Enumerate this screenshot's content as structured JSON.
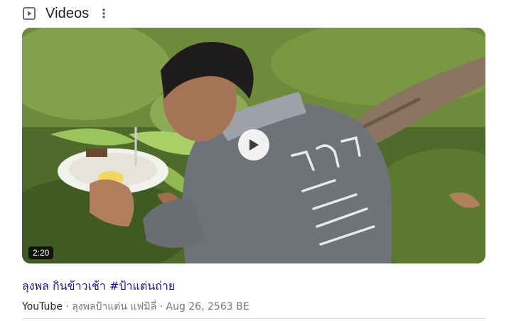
{
  "section": {
    "title": "Videos",
    "icon": "video-play-icon",
    "menu_icon": "more-vert-icon"
  },
  "video": {
    "duration": "2:20",
    "title": "ลุงพล กินข้าวเช้า #ป้าแต่นถ่าย",
    "source": "YouTube",
    "separator": "·",
    "channel": "ลุงพลป้าแต่น แฟมิลี่",
    "date": "Aug 26, 2563 BE",
    "shirt_text": [
      "ร้านลุงพล",
      "อ.นาแซง",
      "ป.บางคาย",
      "โทร.๐๙๗๙๘๖",
      "โทร.๐๑๕๘๔"
    ],
    "colors": {
      "title_link": "#1a0dab",
      "meta_text": "#70757a"
    }
  }
}
